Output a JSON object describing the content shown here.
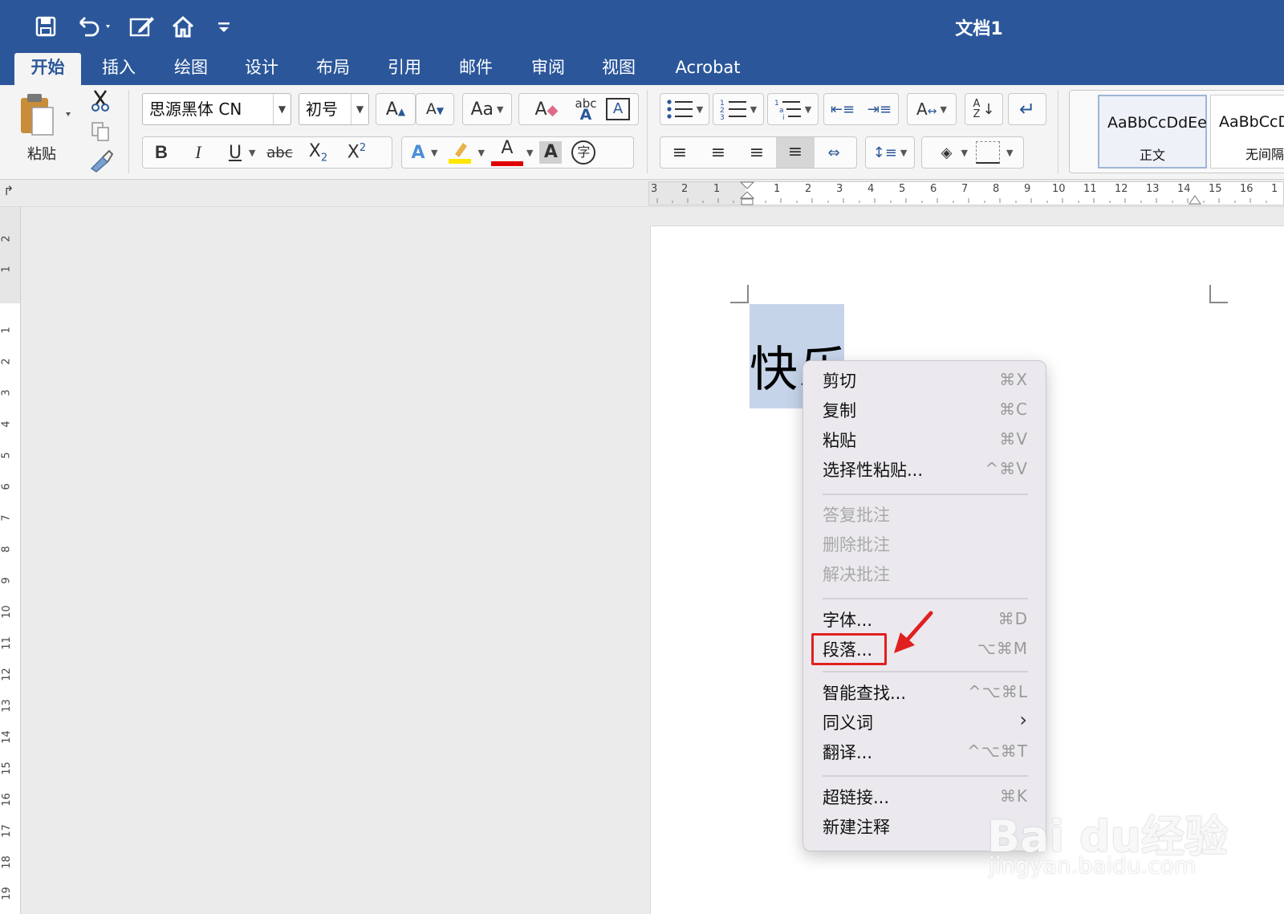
{
  "window": {
    "title": "文档1"
  },
  "tabs": [
    {
      "label": "开始",
      "active": true
    },
    {
      "label": "插入"
    },
    {
      "label": "绘图"
    },
    {
      "label": "设计"
    },
    {
      "label": "布局"
    },
    {
      "label": "引用"
    },
    {
      "label": "邮件"
    },
    {
      "label": "审阅"
    },
    {
      "label": "视图"
    },
    {
      "label": "Acrobat"
    }
  ],
  "ribbon": {
    "paste_label": "粘贴",
    "font_name": "思源黑体 CN",
    "font_size": "初号",
    "styles": [
      {
        "sample": "AaBbCcDdEe",
        "name": "正文"
      },
      {
        "sample": "AaBbCcDdEe",
        "name": "无间隔"
      }
    ]
  },
  "rulers": {
    "h_left": [
      "3",
      "2",
      "1"
    ],
    "h_right": [
      "1",
      "2",
      "3",
      "4",
      "5",
      "6",
      "7",
      "8",
      "9",
      "10",
      "11",
      "12",
      "13",
      "14",
      "15",
      "16",
      "1"
    ],
    "v_top": [
      "2",
      "1"
    ],
    "v_main": [
      "1",
      "2",
      "3",
      "4",
      "5",
      "6",
      "7",
      "8",
      "9",
      "10",
      "11",
      "12",
      "13",
      "14",
      "15",
      "16",
      "17",
      "18",
      "19"
    ]
  },
  "document": {
    "text": "快乐"
  },
  "context_menu": {
    "groups": [
      [
        {
          "label": "剪切",
          "shortcut": "⌘X"
        },
        {
          "label": "复制",
          "shortcut": "⌘C"
        },
        {
          "label": "粘贴",
          "shortcut": "⌘V"
        },
        {
          "label": "选择性粘贴...",
          "shortcut": "^⌘V"
        }
      ],
      [
        {
          "label": "答复批注",
          "shortcut": "",
          "disabled": true
        },
        {
          "label": "删除批注",
          "shortcut": "",
          "disabled": true
        },
        {
          "label": "解决批注",
          "shortcut": "",
          "disabled": true
        }
      ],
      [
        {
          "label": "字体...",
          "shortcut": "⌘D"
        },
        {
          "label": "段落...",
          "shortcut": "⌥⌘M"
        }
      ],
      [
        {
          "label": "智能查找...",
          "shortcut": "^⌥⌘L"
        },
        {
          "label": "同义词",
          "shortcut": "›"
        },
        {
          "label": "翻译...",
          "shortcut": "^⌥⌘T"
        }
      ],
      [
        {
          "label": "超链接...",
          "shortcut": "⌘K"
        },
        {
          "label": "新建注释",
          "shortcut": ""
        }
      ]
    ]
  },
  "watermark": {
    "brand": "Bai du经验",
    "url": "jingyan.baidu.com"
  },
  "colors": {
    "titlebar": "#2b579a",
    "highlight_marker": "#e02020"
  }
}
